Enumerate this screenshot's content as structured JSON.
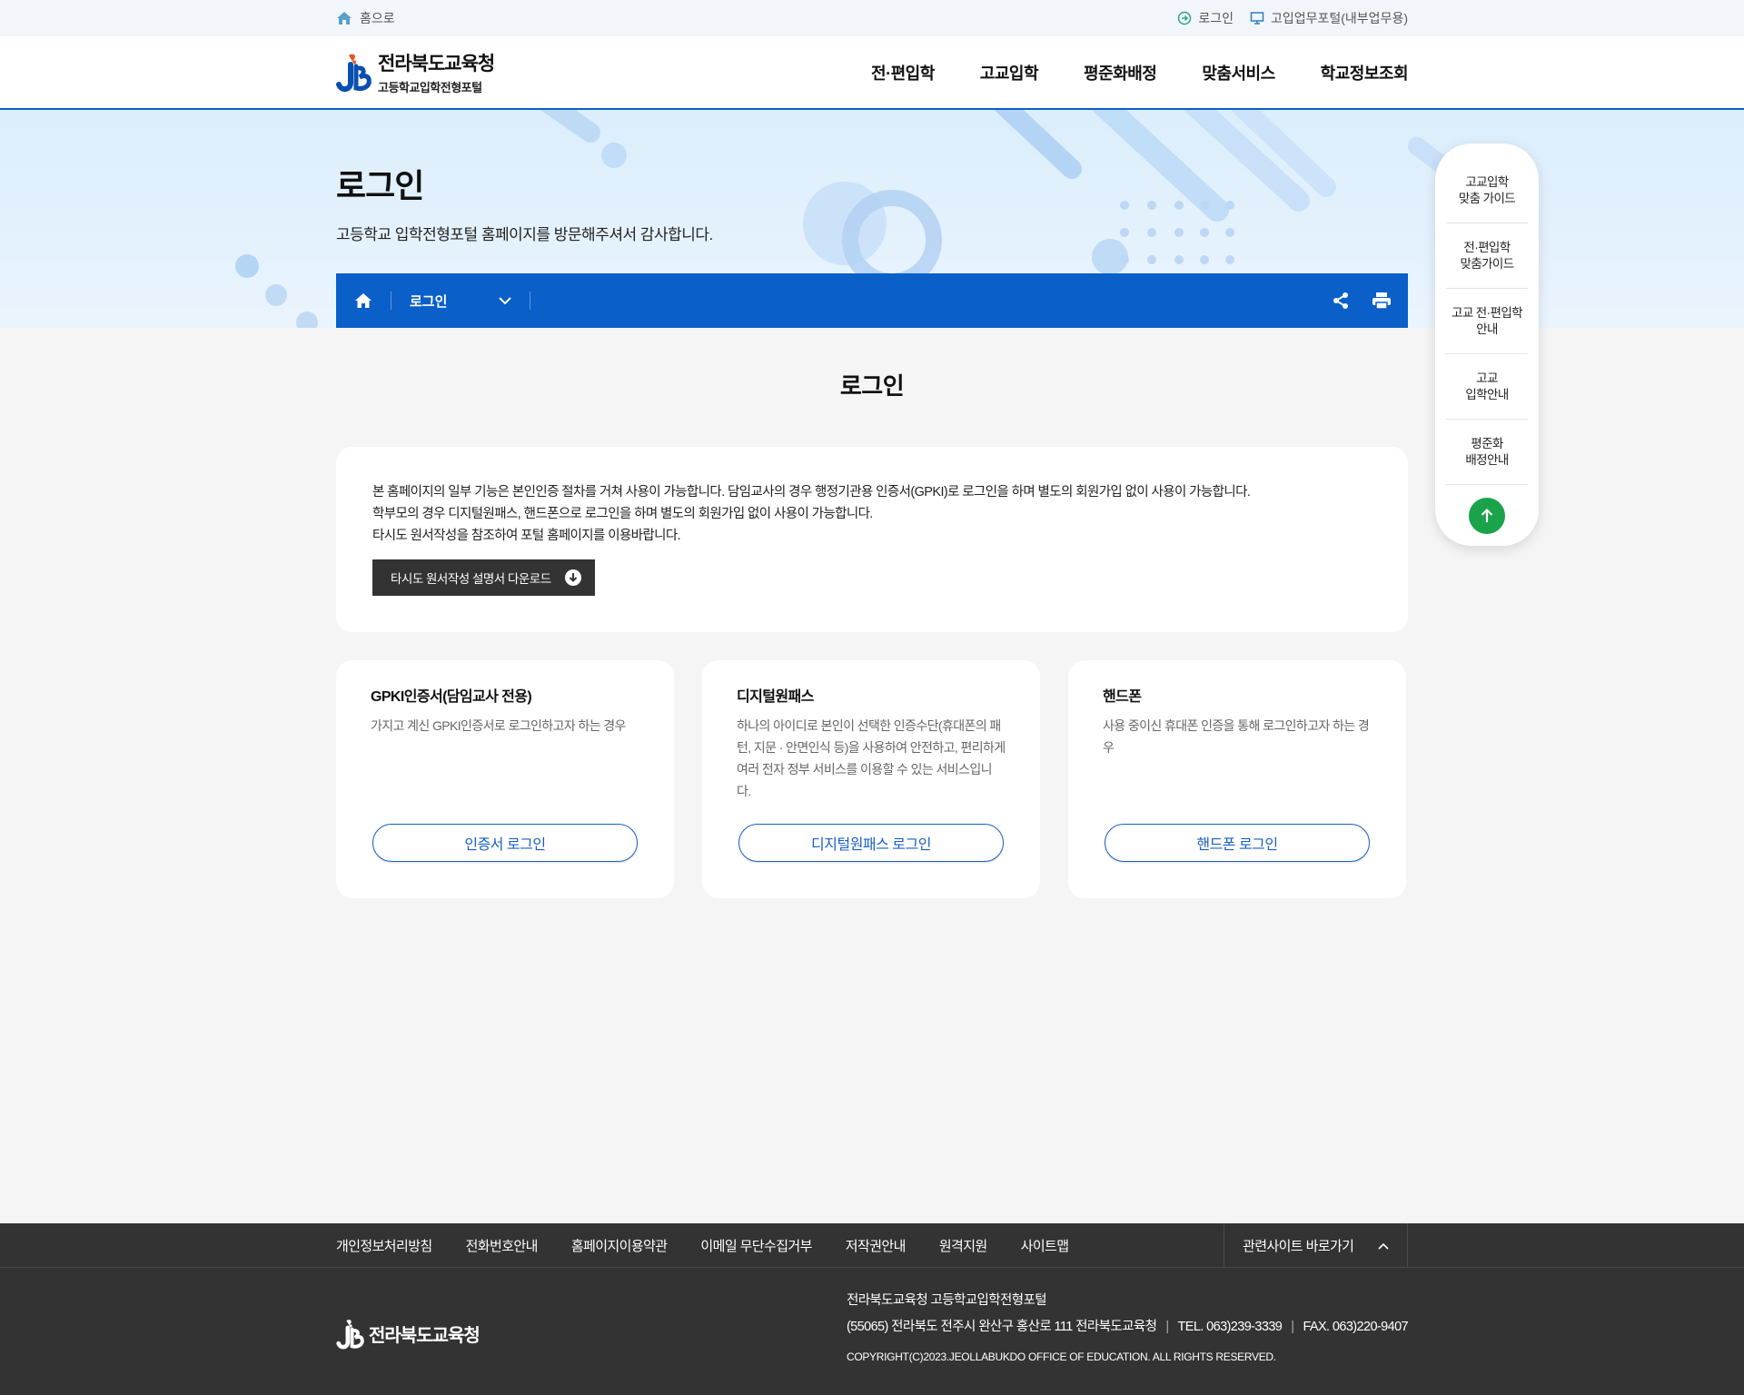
{
  "util": {
    "home_label": "홈으로",
    "login_label": "로그인",
    "portal_label": "고입업무포털(내부업무용)"
  },
  "header": {
    "logo_title": "전라북도교육청",
    "logo_subtitle": "고등학교입학전형포털",
    "nav": [
      "전·편입학",
      "고교입학",
      "평준화배정",
      "맞춤서비스",
      "학교정보조회"
    ]
  },
  "visual": {
    "title": "로그인",
    "subtitle": "고등학교 입학전형포털 홈페이지를 방문해주셔서 감사합니다.",
    "breadcrumb": "로그인"
  },
  "main": {
    "title": "로그인",
    "intro_lines": [
      "본 홈페이지의 일부 기능은 본인인증 절차를 거쳐 사용이 가능합니다. 담임교사의 경우 행정기관용 인증서(GPKI)로 로그인을 하며 별도의 회원가입 없이 사용이 가능합니다.",
      "학부모의 경우 디지털원패스, 핸드폰으로 로그인을 하며 별도의 회원가입 없이 사용이 가능합니다.",
      "타시도 원서작성을 참조하여 포털 홈페이지를 이용바랍니다."
    ],
    "download_label": "타시도 원서작성 설명서 다운로드",
    "cards": [
      {
        "title": "GPKI인증서(담임교사 전용)",
        "desc": "가지고 계신 GPKI인증서로 로그인하고자 하는 경우",
        "button": "인증서 로그인"
      },
      {
        "title": "디지털원패스",
        "desc": "하나의 아이디로 본인이 선택한 인증수단(휴대폰의 패턴, 지문 · 안면인식 등)을 사용하여 안전하고, 편리하게 여러 전자 정부 서비스를 이용할 수 있는 서비스입니다.",
        "button": "디지털원패스 로그인"
      },
      {
        "title": "핸드폰",
        "desc": "사용 중이신 휴대폰 인증을 통해 로그인하고자 하는 경우",
        "button": "핸드폰 로그인"
      }
    ]
  },
  "quick": {
    "items": [
      "고교입학\n맞춤 가이드",
      "전·편입학\n맞춤가이드",
      "고교 전·편입학\n안내",
      "고교\n입학안내",
      "평준화\n배정안내"
    ]
  },
  "footer": {
    "links": [
      "개인정보처리방침",
      "전화번호안내",
      "홈페이지이용약관",
      "이메일 무단수집거부",
      "저작권안내",
      "원격지원",
      "사이트맵"
    ],
    "family_site": "관련사이트 바로가기",
    "logo_title": "전라북도교육청",
    "org": "전라북도교육청 고등학교입학전형포털",
    "address": "(55065) 전라북도 전주시 완산구 홍산로 111 전라북도교육청",
    "tel": "TEL. 063)239-3339",
    "fax": "FAX. 063)220-9407",
    "copyright": "COPYRIGHT(C)2023.JEOLLABUKDO OFFICE OF EDUCATION. ALL RIGHTS RESERVED."
  },
  "colors": {
    "primary": "#0a5fc9",
    "accent_green": "#1aa34a",
    "footer_bg": "#333333"
  }
}
